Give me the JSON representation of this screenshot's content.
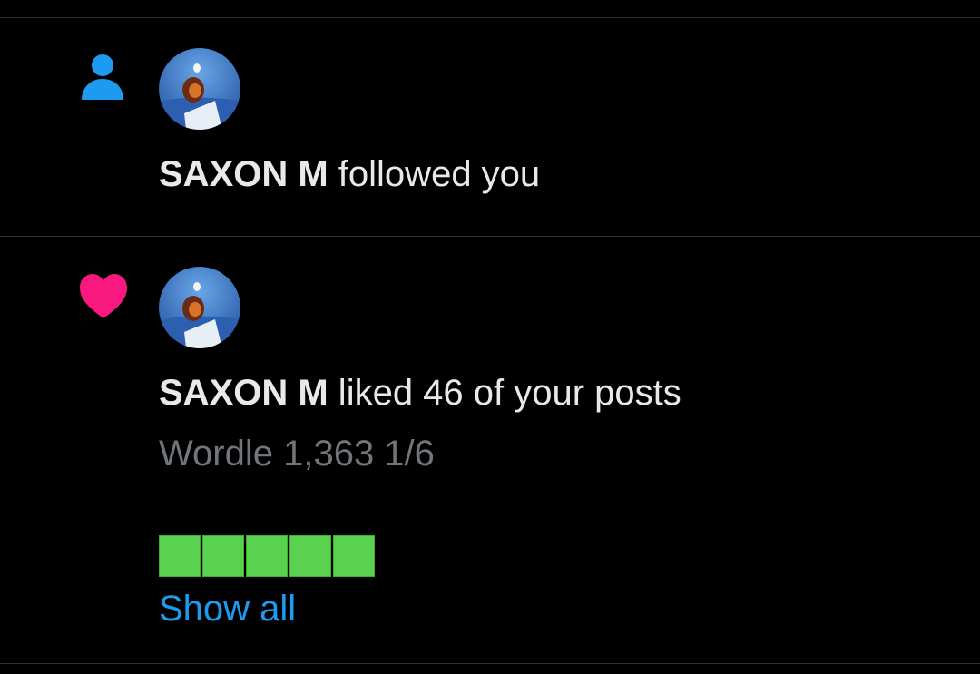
{
  "colors": {
    "background": "#000000",
    "divider": "#2f3336",
    "primary_text": "#e7e9ea",
    "secondary_text": "#71767b",
    "follow_icon": "#1d9bf0",
    "like_icon": "#f91880",
    "link": "#1d9bf0",
    "wordle_green": "#5ad14f"
  },
  "notifications": [
    {
      "type_icon": "person-icon",
      "user_name": "SAXON M",
      "action_text": " followed you"
    },
    {
      "type_icon": "heart-icon",
      "user_name": "SAXON M",
      "action_text": " liked 46 of your posts",
      "post_preview": "Wordle 1,363 1/6",
      "wordle_squares": [
        "green",
        "green",
        "green",
        "green",
        "green"
      ],
      "show_all_label": "Show all"
    }
  ]
}
